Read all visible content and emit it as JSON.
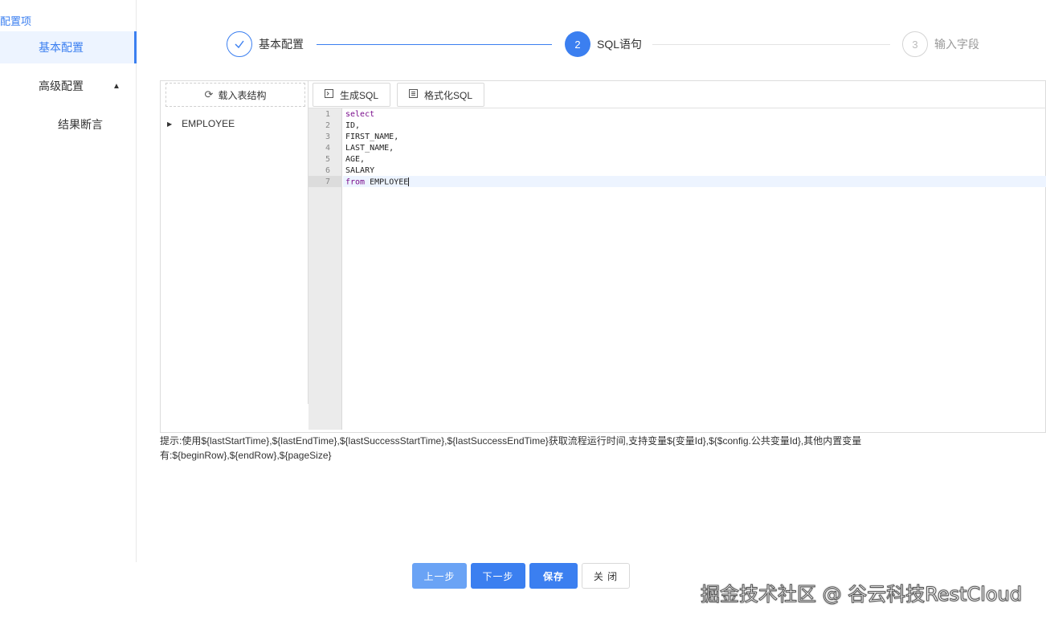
{
  "sidebar": {
    "title": "配置项",
    "items": [
      {
        "label": "基本配置",
        "active": true
      },
      {
        "label": "高级配置",
        "expanded": true
      },
      {
        "label": "结果断言"
      }
    ]
  },
  "steps": [
    {
      "number": "1",
      "label": "基本配置",
      "state": "done"
    },
    {
      "number": "2",
      "label": "SQL语句",
      "state": "current"
    },
    {
      "number": "3",
      "label": "输入字段",
      "state": "pending"
    }
  ],
  "left_pane": {
    "load_button": "载入表结构",
    "tree": [
      {
        "label": "EMPLOYEE"
      }
    ]
  },
  "toolbar": {
    "generate_sql": "生成SQL",
    "format_sql": "格式化SQL"
  },
  "editor": {
    "lines": [
      {
        "num": "1",
        "text": "select"
      },
      {
        "num": "2",
        "text": "ID,"
      },
      {
        "num": "3",
        "text": "FIRST_NAME,"
      },
      {
        "num": "4",
        "text": "LAST_NAME,"
      },
      {
        "num": "5",
        "text": "AGE,"
      },
      {
        "num": "6",
        "text": "SALARY"
      },
      {
        "num": "7",
        "text": "from EMPLOYEE"
      }
    ]
  },
  "hint": {
    "line1": "提示:使用${lastStartTime},${lastEndTime},${lastSuccessStartTime},${lastSuccessEndTime}获取流程运行时间,支持变量${变量Id},${$config.公共变量Id},其他内置变量",
    "line2": "有:${beginRow},${endRow},${pageSize}"
  },
  "footer": {
    "prev": "上一步",
    "next": "下一步",
    "save": "保存",
    "close": "关 闭"
  },
  "watermark": "掘金技术社区 @ 谷云科技RestCloud",
  "colors": {
    "accent": "#3b7ff0",
    "accent_light": "#6aa3f5"
  }
}
